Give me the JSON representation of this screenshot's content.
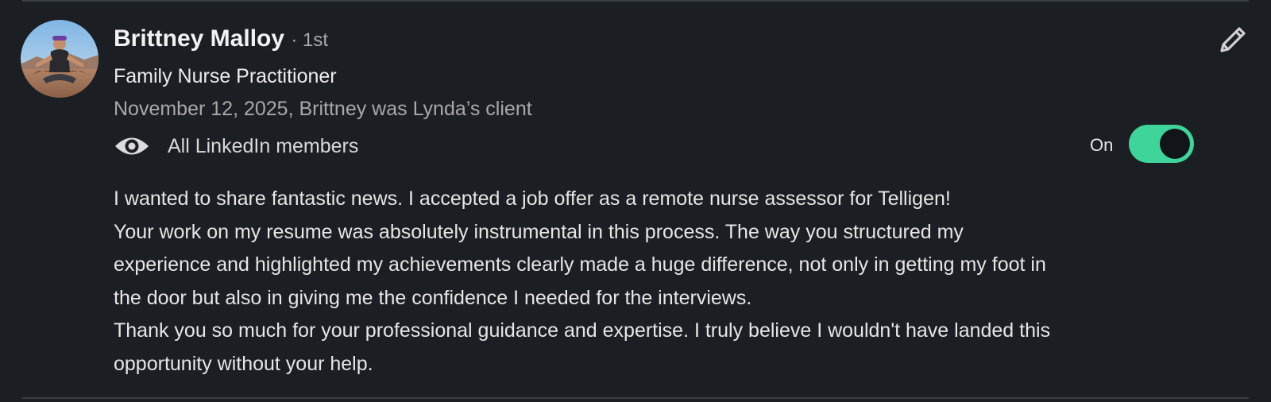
{
  "recommendation": {
    "author_name": "Brittney Malloy",
    "connection_degree": "· 1st",
    "headline": "Family Nurse Practitioner",
    "meta": "November 12, 2025, Brittney was Lynda’s client",
    "visibility": {
      "icon": "eye-icon",
      "label": "All LinkedIn members"
    },
    "toggle": {
      "label": "On",
      "state": "on",
      "color": "#3ed49a"
    },
    "edit_icon": "pencil-icon",
    "body_lines": [
      "I wanted to share fantastic news. I accepted a job offer as a remote nurse assessor for Telligen!",
      "Your work on my resume was absolutely instrumental in this process. The way you structured my",
      "experience and highlighted my achievements clearly made a huge difference, not only in getting my foot in",
      "the door but also in giving me the confidence I needed for the interviews.",
      "Thank you so much for your professional guidance and expertise. I truly believe I wouldn't have landed this",
      "opportunity without your help."
    ]
  }
}
